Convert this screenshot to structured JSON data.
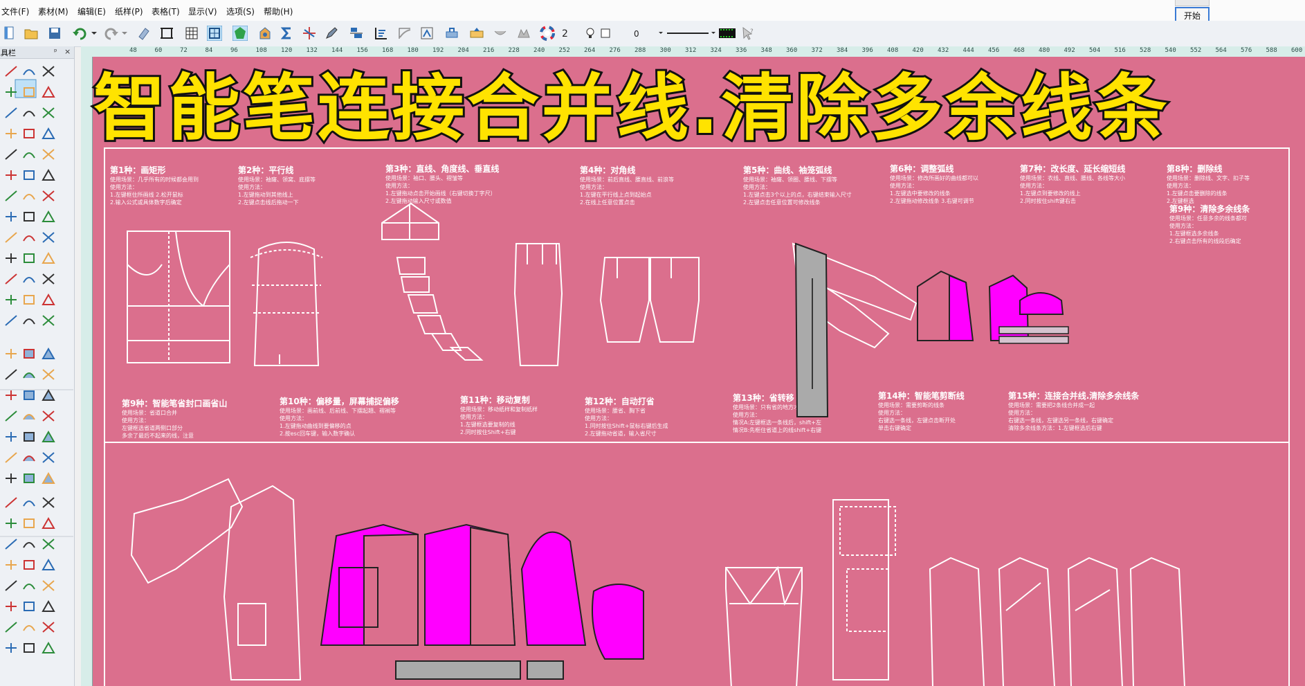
{
  "menu": [
    "文件(F)",
    "素材(M)",
    "编辑(E)",
    "纸样(P)",
    "表格(T)",
    "显示(V)",
    "选项(S)",
    "帮助(H)"
  ],
  "start_button": "开始",
  "toolbar": {
    "layer_count": "2",
    "zero": "0"
  },
  "panel": {
    "title": "工具栏",
    "pin": "ᵖ",
    "close": "×"
  },
  "ruler_labels": [
    "48",
    "60",
    "72",
    "84",
    "96",
    "108",
    "120",
    "132",
    "144",
    "156",
    "168",
    "180",
    "192",
    "204",
    "216",
    "228",
    "240",
    "252",
    "264",
    "276",
    "288",
    "300",
    "312",
    "324",
    "336",
    "348",
    "360",
    "372",
    "384",
    "396",
    "408",
    "420",
    "432",
    "444",
    "456",
    "468",
    "480",
    "492",
    "504",
    "516",
    "528",
    "540",
    "552",
    "564",
    "576",
    "588"
  ],
  "ruler_tail": "600",
  "overlay_title": "智能笔连接合并线.清除多余线条",
  "cards": {
    "c1": {
      "title": "第1种：画矩形",
      "l1": "使用场景：几乎所有的时候都会用到",
      "l2": "使用方法：",
      "l3": "1.左键框住所画线 2.松开鼠标",
      "l4": "2.输入公式或具体数字后确定"
    },
    "c2": {
      "title": "第2种：平行线",
      "l1": "使用场景：袖窿、领窝、底摆等",
      "l2": "使用方法：",
      "l3": "1.左键拖动到其他线上",
      "l4": "2.左键点击线后拖动一下"
    },
    "c3": {
      "title": "第3种：直线、角度线、垂直线",
      "l1": "使用场景：袖口、腰头、褶皱等",
      "l2": "使用方法：",
      "l3": "1.左键拖动点击开始画线（右键切换丁字尺）",
      "l4": "2.左键拖动输入尺寸或数值"
    },
    "c4": {
      "title": "第4种：对角线",
      "l1": "使用场景：前后直线、腰直线、前浪等",
      "l2": "使用方法：",
      "l3": "1.左键在平行线上点到起始点",
      "l4": "2.在线上任意位置点击"
    },
    "c5": {
      "title": "第5种：曲线、袖笼弧线",
      "l1": "使用场景：袖窿、领圈、腰线、下摆等",
      "l2": "使用方法：",
      "l3": "1.左键点击3个以上的点，右键结束输入尺寸",
      "l4": "2.左键点击任意位置可修改线条"
    },
    "c6": {
      "title": "第6种：调整弧线",
      "l1": "使用场景：修改所画好的曲线都可以",
      "l2": "使用方法：",
      "l3": "1.左键选中要修改的线条",
      "l4": "2.左键拖动修改线条 3.右键可调节"
    },
    "c7": {
      "title": "第7种：改长度、延长缩短线",
      "l1": "使用场景：衣线、直线、腰线、各线等大小",
      "l2": "使用方法：",
      "l3": "1.左键点到要修改的线上",
      "l4": "2.同时按住shift键右击"
    },
    "c8": {
      "title": "第8种：删除线",
      "l1": "使用场景：删除线、文字、扣子等",
      "l2": "使用方法：",
      "l3": "1.左键点击要删除的线条",
      "l4": "2.左键框选"
    },
    "c9": {
      "title": "第9种：清除多余线条",
      "l1": "使用场景：任意多余的线条都可",
      "l2": "使用方法：",
      "l3": "1.左键框选多余线条",
      "l4": "2.右键点击所有的线段后确定"
    },
    "c10": {
      "title": "第9种：智能笔省封口画省山",
      "l1": "使用场景：省道口合并",
      "l2": "使用方法：",
      "l3": "左键框选省道两侧口部分",
      "l4": "多余了最后不起来的线，注意"
    },
    "c11": {
      "title": "第10种：偏移量，屏幕捕捉偏移",
      "l1": "使用场景：画前线、后前线、下摆起翘、褶裥等",
      "l2": "使用方法：",
      "l3": "1.左键拖动曲线到要偏移的点",
      "l4": "2.按esc回车键，输入数字确认"
    },
    "c12": {
      "title": "第11种：移动复制",
      "l1": "使用场景：移动纸样和复制纸样",
      "l2": "使用方法：",
      "l3": "1.左键框选要复制的线",
      "l4": "2.同时按住Shift+右键"
    },
    "c13": {
      "title": "第12种：自动打省",
      "l1": "使用场景：腰省、胸下省",
      "l2": "使用方法：",
      "l3": "1.同时按住Shift+鼠标右键后生成",
      "l4": "2.左键拖动省道，输入省尺寸"
    },
    "c14": {
      "title": "第13种：省转移",
      "l1": "使用场景：只有省的地方才能转移",
      "l2": "使用方法：",
      "l3": "情况A:左键框选一条线后，shift+左",
      "l4": "情况B:先框住省道上的线shift+右键"
    },
    "c15": {
      "title": "第14种：智能笔剪断线",
      "l1": "使用场景：需要剪断的线条",
      "l2": "使用方法：",
      "l3": "右键选一条线，左键点击断开处",
      "l4": "单击右键确定"
    },
    "c16": {
      "title": "第15种：连接合并线.清除多余线条",
      "l1": "使用场景：需要把2条线合并成一起",
      "l2": "使用方法：",
      "l3": "右键选一条线，左键选另一条线，右键确定",
      "l4": "清除多余线条方法：1.左键框选后右键"
    }
  },
  "colors": {
    "canvas": "#db6f8d",
    "magenta": "#ff00ff",
    "title_yellow": "#ffe300",
    "start_border": "#3a7bd5"
  }
}
